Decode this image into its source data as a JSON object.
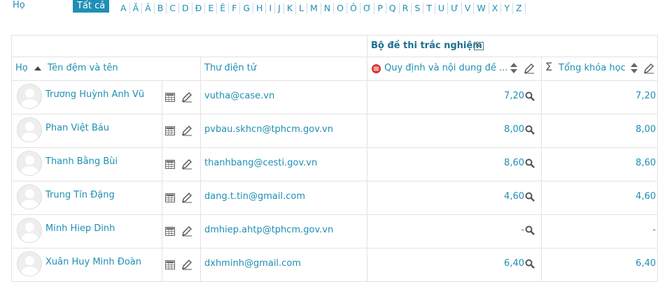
{
  "filter": {
    "label": "Họ",
    "all_label": "Tất cả",
    "letters": [
      "A",
      "Ă",
      "Â",
      "B",
      "C",
      "D",
      "Đ",
      "E",
      "Ê",
      "F",
      "G",
      "H",
      "I",
      "J",
      "K",
      "L",
      "M",
      "N",
      "O",
      "Ô",
      "Ơ",
      "P",
      "Q",
      "R",
      "S",
      "T",
      "U",
      "Ư",
      "V",
      "W",
      "X",
      "Y",
      "Z"
    ]
  },
  "table": {
    "group_title": "Bộ đề thi trắc nghiệm",
    "columns": {
      "name": "Họ",
      "name_sub": "Tên đệm và tên",
      "email": "Thư điện tử",
      "quiz": "Quy định và nội dung đề ...",
      "total": "Tổng khóa học"
    },
    "rows": [
      {
        "name": "Trương Huỳnh Anh Vũ",
        "email": "vutha@case.vn",
        "grade": "7,20",
        "total": "7,20"
      },
      {
        "name": "Phan Việt Báu",
        "email": "pvbau.skhcn@tphcm.gov.vn",
        "grade": "8,00",
        "total": "8,00"
      },
      {
        "name": "Thanh Bằng Bùi",
        "email": "thanhbang@cesti.gov.vn",
        "grade": "8,60",
        "total": "8,60"
      },
      {
        "name": "Trung Tín Đặng",
        "email": "dang.t.tin@gmail.com",
        "grade": "4,60",
        "total": "4,60"
      },
      {
        "name": "Minh Hiep Dinh",
        "email": "dmhiep.ahtp@tphcm.gov.vn",
        "grade": "-",
        "total": "-"
      },
      {
        "name": "Xuân Huy Minh Đoàn",
        "email": "dxhminh@gmail.com",
        "grade": "6,40",
        "total": "6,40"
      }
    ]
  },
  "colors": {
    "accent": "#1f8fb5",
    "grid_line": "#e3e3e3"
  }
}
